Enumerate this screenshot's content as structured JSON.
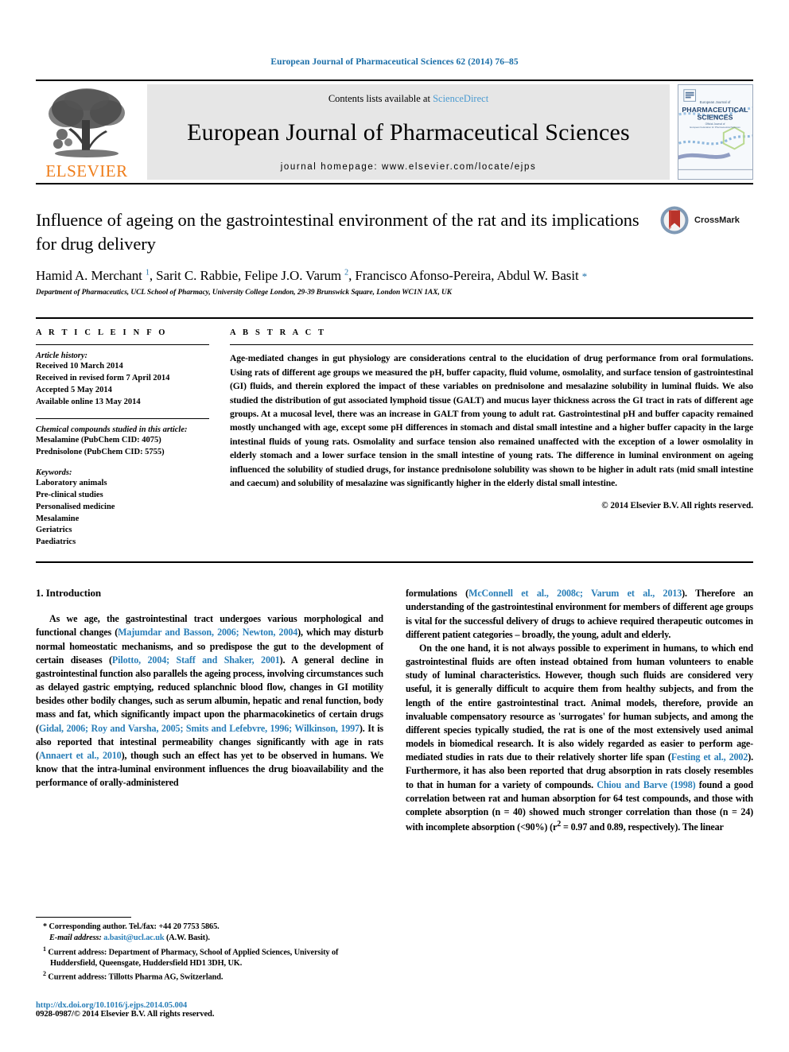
{
  "running_head": "European Journal of Pharmaceutical Sciences 62 (2014) 76–85",
  "masthead": {
    "publisher_name": "ELSEVIER",
    "contents_prefix": "Contents lists available at ",
    "sciencedirect": "ScienceDirect",
    "journal_title": "European Journal of Pharmaceutical Sciences",
    "homepage": "journal homepage: www.elsevier.com/locate/ejps",
    "cover": {
      "line1": "European Journal of",
      "line2": "PHARMACEUTICAL",
      "line3": "SCIENCES",
      "line4": "Official Journal of",
      "line5": "European Federation for Pharmaceutical Sciences"
    }
  },
  "article": {
    "title": "Influence of ageing on the gastrointestinal environment of the rat and its implications for drug delivery",
    "authors_html": "Hamid A. Merchant <sup>1</sup>, Sarit C. Rabbie, Felipe J.O. Varum <sup>2</sup>, Francisco Afonso-Pereira, Abdul W. Basit <span class=\"star\">*</span>",
    "affiliation": "Department of Pharmaceutics, UCL School of Pharmacy, University College London, 29-39 Brunswick Square, London WC1N 1AX, UK",
    "crossmark_label": "CrossMark"
  },
  "info": {
    "heading": "A R T I C L E   I N F O",
    "history_label": "Article history:",
    "history": [
      "Received 10 March 2014",
      "Received in revised form 7 April 2014",
      "Accepted 5 May 2014",
      "Available online 13 May 2014"
    ],
    "compounds_label": "Chemical compounds studied in this article:",
    "compounds": [
      "Mesalamine (PubChem CID: 4075)",
      "Prednisolone (PubChem CID: 5755)"
    ],
    "keywords_label": "Keywords:",
    "keywords": [
      "Laboratory animals",
      "Pre-clinical studies",
      "Personalised medicine",
      "Mesalamine",
      "Geriatrics",
      "Paediatrics"
    ]
  },
  "abstract": {
    "heading": "A B S T R A C T",
    "text": "Age-mediated changes in gut physiology are considerations central to the elucidation of drug performance from oral formulations. Using rats of different age groups we measured the pH, buffer capacity, fluid volume, osmolality, and surface tension of gastrointestinal (GI) fluids, and therein explored the impact of these variables on prednisolone and mesalazine solubility in luminal fluids. We also studied the distribution of gut associated lymphoid tissue (GALT) and mucus layer thickness across the GI tract in rats of different age groups. At a mucosal level, there was an increase in GALT from young to adult rat. Gastrointestinal pH and buffer capacity remained mostly unchanged with age, except some pH differences in stomach and distal small intestine and a higher buffer capacity in the large intestinal fluids of young rats. Osmolality and surface tension also remained unaffected with the exception of a lower osmolality in elderly stomach and a lower surface tension in the small intestine of young rats. The difference in luminal environment on ageing influenced the solubility of studied drugs, for instance prednisolone solubility was shown to be higher in adult rats (mid small intestine and caecum) and solubility of mesalazine was significantly higher in the elderly distal small intestine.",
    "copyright": "© 2014 Elsevier B.V. All rights reserved."
  },
  "body": {
    "section_heading": "1. Introduction",
    "left_para1_parts": [
      {
        "t": "As we age, the gastrointestinal tract undergoes various morphological and functional changes (",
        "r": false
      },
      {
        "t": "Majumdar and Basson, 2006; Newton, 2004",
        "r": true
      },
      {
        "t": "), which may disturb normal homeostatic mechanisms, and so predispose the gut to the development of certain diseases (",
        "r": false
      },
      {
        "t": "Pilotto, 2004; Staff and Shaker, 2001",
        "r": true
      },
      {
        "t": "). A general decline in gastrointestinal function also parallels the ageing process, involving circumstances such as delayed gastric emptying, reduced splanchnic blood flow, changes in GI motility besides other bodily changes, such as serum albumin, hepatic and renal function, body mass and fat, which significantly impact upon the pharmacokinetics of certain drugs (",
        "r": false
      },
      {
        "t": "Gidal, 2006; Roy and Varsha, 2005; Smits and Lefebvre, 1996; Wilkinson, 1997",
        "r": true
      },
      {
        "t": "). It is also reported that intestinal permeability changes significantly with age in rats (",
        "r": false
      },
      {
        "t": "Annaert et al., 2010",
        "r": true
      },
      {
        "t": "), though such an effect has yet to be observed in humans. We know that the intra-luminal environment influences the drug bioavailability and the performance of orally-administered ",
        "r": false
      }
    ],
    "right_para1_parts": [
      {
        "t": "formulations (",
        "r": false
      },
      {
        "t": "McConnell et al., 2008c; Varum et al., 2013",
        "r": true
      },
      {
        "t": "). Therefore an understanding of the gastrointestinal environment for members of different age groups is vital for the successful delivery of drugs to achieve required therapeutic outcomes in different patient categories – broadly, the young, adult and elderly.",
        "r": false
      }
    ],
    "right_para2_parts": [
      {
        "t": "On the one hand, it is not always possible to experiment in humans, to which end gastrointestinal fluids are often instead obtained from human volunteers to enable study of luminal characteristics. However, though such fluids are considered very useful, it is generally difficult to acquire them from healthy subjects, and from the length of the entire gastrointestinal tract. Animal models, therefore, provide an invaluable compensatory resource as 'surrogates' for human subjects, and among the different species typically studied, the rat is one of the most extensively used animal models in biomedical research. It is also widely regarded as easier to perform age-mediated studies in rats due to their relatively shorter life span (",
        "r": false
      },
      {
        "t": "Festing et al., 2002",
        "r": true
      },
      {
        "t": "). Furthermore, it has also been reported that drug absorption in rats closely resembles to that in human for a variety of compounds. ",
        "r": false
      },
      {
        "t": "Chiou and Barve (1998)",
        "r": true
      },
      {
        "t": " found a good correlation between rat and human absorption for 64 test compounds, and those with complete absorption (n = 40) showed much stronger correlation than those (n = 24) with incomplete absorption (<90%) (r",
        "r": false
      },
      {
        "t": "2",
        "r": false,
        "sup": true
      },
      {
        "t": " = 0.97 and 0.89, respectively). The linear",
        "r": false
      }
    ]
  },
  "footnotes": {
    "corresponding": "* Corresponding author. Tel./fax: +44 20 7753 5865.",
    "email_label": "E-mail address:",
    "email": "a.basit@ucl.ac.uk",
    "email_suffix": " (A.W. Basit).",
    "note1": "Current address: Department of Pharmacy, School of Applied Sciences, University of Huddersfield, Queensgate, Huddersfield HD1 3DH, UK.",
    "note2": "Current address: Tillotts Pharma AG, Switzerland.",
    "doi": "http://dx.doi.org/10.1016/j.ejps.2014.05.004",
    "issn": "0928-0987/© 2014 Elsevier B.V. All rights reserved."
  },
  "colors": {
    "link": "#2a7fb8",
    "running_head": "#1a6ea8",
    "elsevier_orange": "#ef7d1a",
    "band_gray": "#e6e6e6",
    "crossmark_red": "#b9332a",
    "crossmark_blue": "#7f99b5"
  }
}
